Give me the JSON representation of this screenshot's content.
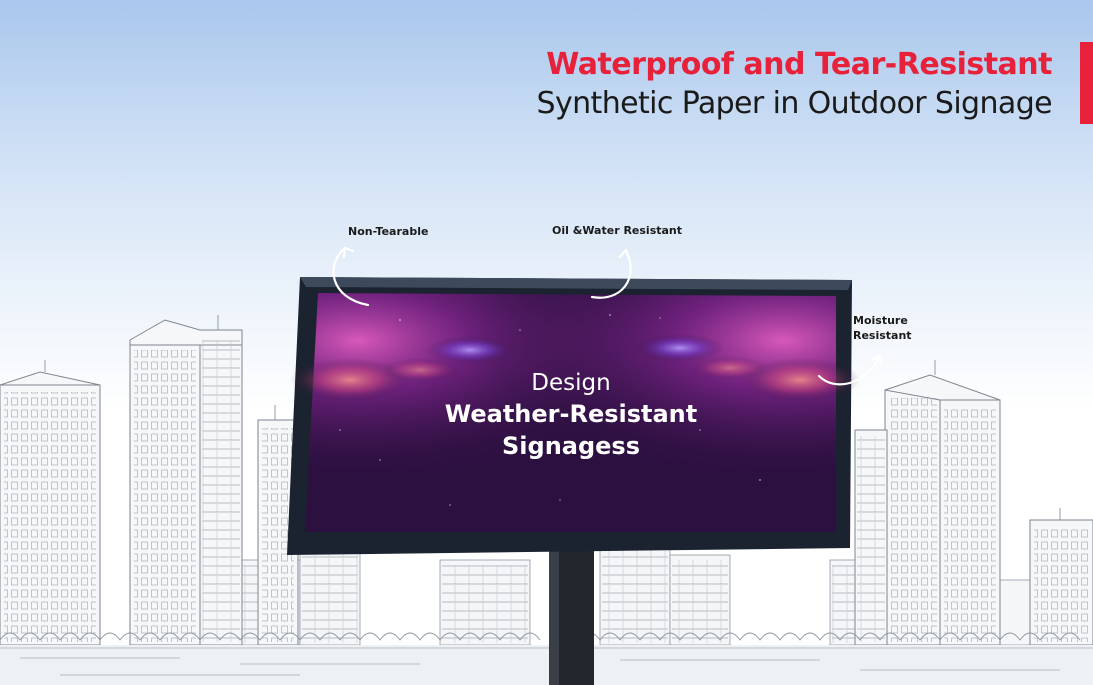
{
  "heading": {
    "line1": "Waterproof and Tear-Resistant",
    "line2": "Synthetic Paper in Outdoor Signage"
  },
  "callouts": {
    "non_tearable": "Non-Tearable",
    "oil_water": "Oil &Water Resistant",
    "moisture_line1": "Moisture",
    "moisture_line2": "Resistant"
  },
  "billboard": {
    "line1": "Design",
    "line2": "Weather-Resistant",
    "line3": "Signagess"
  },
  "colors": {
    "accent": "#e8213a",
    "board_screen": "#2c1040",
    "frame": "#1c2330"
  }
}
